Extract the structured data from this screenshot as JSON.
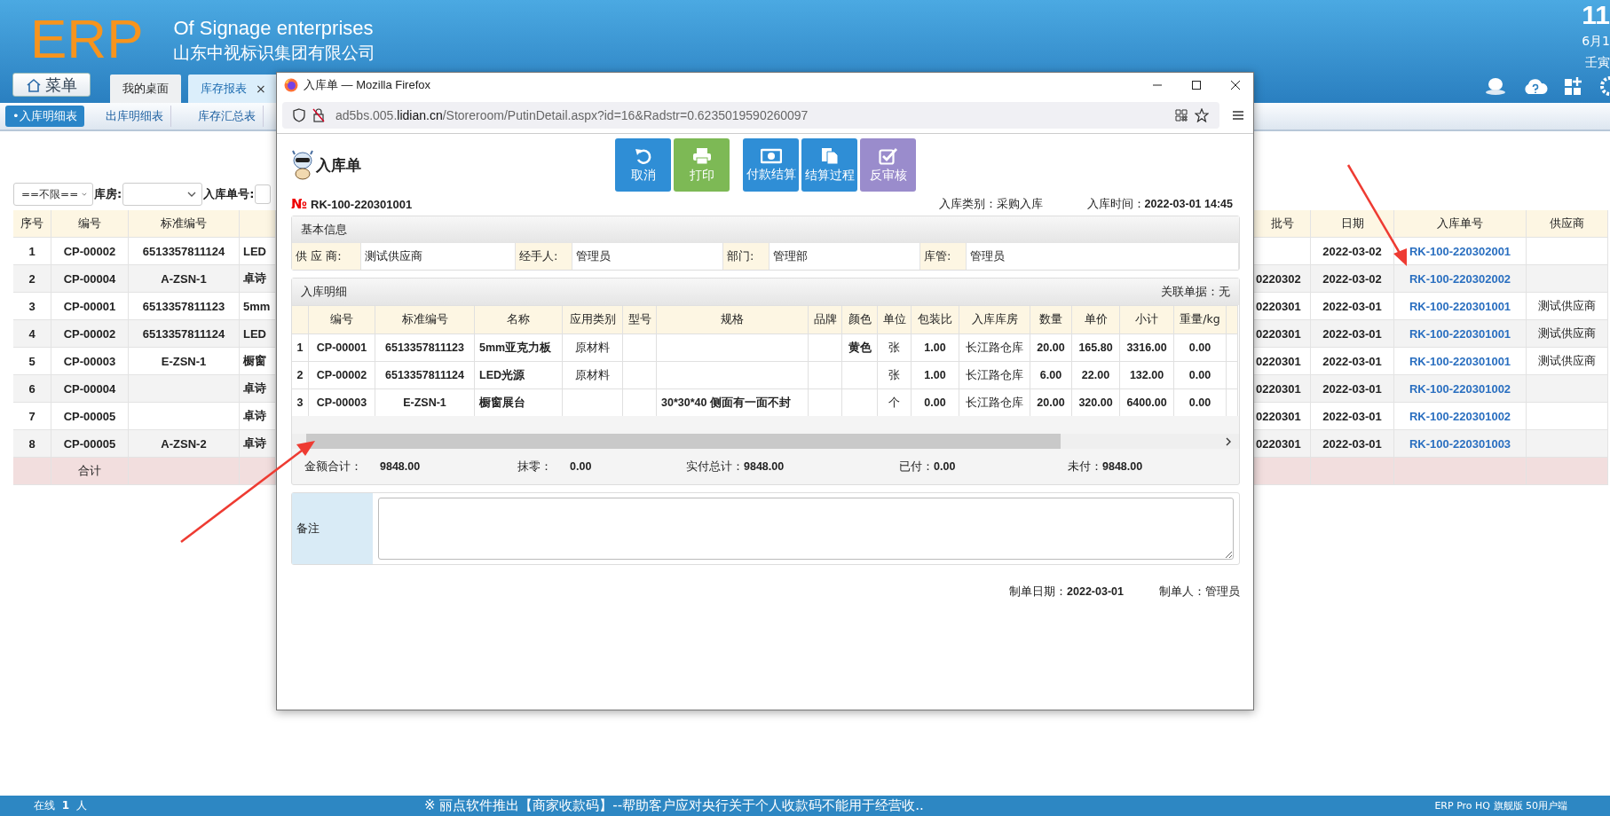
{
  "header": {
    "logo": "ERP",
    "title_en": "Of Signage enterprises",
    "title_cn": "山东中视标识集团有限公司",
    "clock": {
      "time": "11",
      "date": "6月1",
      "lunar": "壬寅"
    }
  },
  "menu_button": "菜单",
  "tabs": [
    {
      "label": "我的桌面",
      "selected": false
    },
    {
      "label": "库存报表",
      "selected": true,
      "close": "×"
    }
  ],
  "subtabs": [
    {
      "label": "•入库明细表",
      "selected": true
    },
    {
      "label": "出库明细表",
      "selected": false
    },
    {
      "label": "库存汇总表",
      "selected": false
    }
  ],
  "filter": {
    "status_select": "==不限==",
    "warehouse_label": "库房:",
    "order_label": "入库单号:"
  },
  "table": {
    "left_columns": [
      "序号",
      "编号",
      "标准编号"
    ],
    "right_columns": [
      "批号",
      "日期",
      "入库单号",
      "供应商"
    ],
    "rows": [
      {
        "no": "1",
        "code": "CP-00002",
        "std_code": "6513357811124",
        "column_4": "LED",
        "date": "2022-03-02",
        "order_no": "RK-100-220302001"
      },
      {
        "no": "2",
        "code": "CP-00004",
        "std_code": "A-ZSN-1",
        "column_4": "卓诗",
        "batch": "0220302",
        "date": "2022-03-02",
        "order_no": "RK-100-220302002"
      },
      {
        "no": "3",
        "code": "CP-00001",
        "std_code": "6513357811123",
        "column_4": "5mm",
        "batch": "0220301",
        "date": "2022-03-01",
        "order_no": "RK-100-220301001",
        "supplier": "测试供应商"
      },
      {
        "no": "4",
        "code": "CP-00002",
        "std_code": "6513357811124",
        "column_4": "LED",
        "batch": "0220301",
        "date": "2022-03-01",
        "order_no": "RK-100-220301001",
        "supplier": "测试供应商"
      },
      {
        "no": "5",
        "code": "CP-00003",
        "std_code": "E-ZSN-1",
        "column_4": "橱窗",
        "batch": "0220301",
        "date": "2022-03-01",
        "order_no": "RK-100-220301001",
        "supplier": "测试供应商"
      },
      {
        "no": "6",
        "code": "CP-00004",
        "column_4": "卓诗",
        "batch": "0220301",
        "date": "2022-03-01",
        "order_no": "RK-100-220301002"
      },
      {
        "no": "7",
        "code": "CP-00005",
        "column_4": "卓诗",
        "batch": "0220301",
        "date": "2022-03-01",
        "order_no": "RK-100-220301002"
      },
      {
        "no": "8",
        "code": "CP-00005",
        "std_code": "A-ZSN-2",
        "column_4": "卓诗",
        "batch": "0220301",
        "date": "2022-03-01",
        "order_no": "RK-100-220301003"
      }
    ],
    "total_label": "合计"
  },
  "popup": {
    "title": "入库单 — Mozilla Firefox",
    "url": {
      "host_prefix": "ad5bs.005.",
      "domain": "lidian.cn",
      "path": "/Storeroom/PutinDetail.aspx?id=16&Radstr=0.6235019590260097"
    },
    "form_title": "入库单",
    "actions": [
      {
        "label": "取消",
        "kind": "undo",
        "color": "#2f8ed6"
      },
      {
        "label": "打印",
        "kind": "print",
        "color": "#7db955"
      },
      {
        "label": "付款结算",
        "kind": "money",
        "color": "#2f8ed6"
      },
      {
        "label": "结算过程",
        "kind": "document",
        "color": "#2f8ed6"
      },
      {
        "label": "反审核",
        "kind": "check",
        "color": "#9a8ccc"
      }
    ],
    "number_mark": "№",
    "number": "RK-100-220301001",
    "type_label": "入库类别：",
    "type_value": "采购入库",
    "time_label": "入库时间：",
    "time_value": "2022-03-01 14:45",
    "basic": {
      "heading": "基本信息",
      "fields": [
        {
          "label": "供 应 商:",
          "value": "测试供应商"
        },
        {
          "label": "经手人:",
          "value": "管理员"
        },
        {
          "label": "部门:",
          "value": "管理部"
        },
        {
          "label": "库管:",
          "value": "管理员"
        }
      ]
    },
    "detail": {
      "heading": "入库明细",
      "linked_label": "关联单据：",
      "linked_value": "无",
      "columns": [
        "编号",
        "标准编号",
        "名称",
        "应用类别",
        "型号",
        "规格",
        "品牌",
        "颜色",
        "单位",
        "包装比",
        "入库库房",
        "数量",
        "单价",
        "小计",
        "重量/kg"
      ],
      "rows": [
        {
          "index": "1",
          "code": "CP-00001",
          "std": "6513357811123",
          "name": "5mm亚克力板",
          "category": "原材料",
          "tint": "黄色",
          "unit": "张",
          "pack": "1.00",
          "warehouse": "长江路仓库",
          "qty": "20.00",
          "price": "165.80",
          "subtotal": "3316.00",
          "weight": "0.00"
        },
        {
          "index": "2",
          "code": "CP-00002",
          "std": "6513357811124",
          "name": "LED光源",
          "category": "原材料",
          "unit": "张",
          "pack": "1.00",
          "warehouse": "长江路仓库",
          "qty": "6.00",
          "price": "22.00",
          "subtotal": "132.00",
          "weight": "0.00"
        },
        {
          "index": "3",
          "code": "CP-00003",
          "std": "E-ZSN-1",
          "name": "橱窗展台",
          "spec": "30*30*40 侧面有一面不封",
          "unit": "个",
          "pack": "0.00",
          "warehouse": "长江路仓库",
          "qty": "20.00",
          "price": "320.00",
          "subtotal": "6400.00",
          "weight": "0.00"
        }
      ],
      "totals": [
        {
          "label": "金额合计：",
          "value": "9848.00"
        },
        {
          "label": "抹零：",
          "value": "0.00"
        },
        {
          "label": "实付总计：",
          "value": "9848.00"
        },
        {
          "label": "已付：",
          "value": "0.00"
        },
        {
          "label": "未付：",
          "value": "9848.00"
        }
      ]
    },
    "remark_label": "备注",
    "footer": {
      "date_label": "制单日期：",
      "date_value": "2022-03-01",
      "maker_label": "制单人：",
      "maker_value": "管理员"
    }
  },
  "status_bar": {
    "online_label": "在线",
    "online_count": "1",
    "online_unit": "人",
    "notice": "※ 丽点软件推出【商家收款码】--帮助客户应对央行关于个人收款码不能用于经营收..",
    "edition": "ERP Pro HQ 旗舰版 50用户端"
  }
}
